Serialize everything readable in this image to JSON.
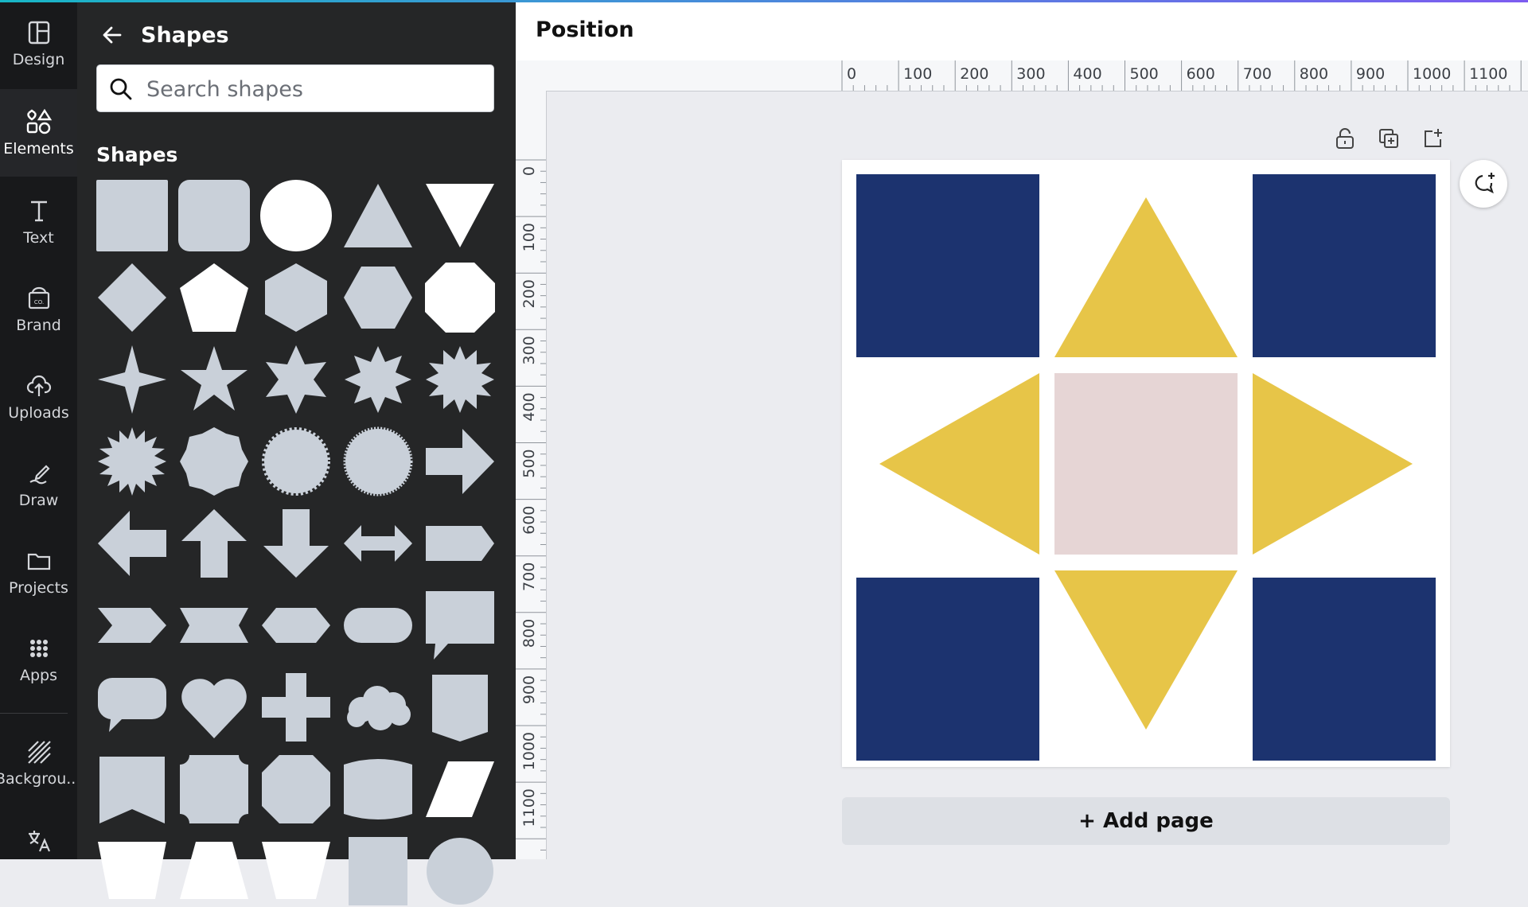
{
  "rail": {
    "items": [
      {
        "label": "Design",
        "icon": "layout-icon"
      },
      {
        "label": "Elements",
        "icon": "shapes-icon"
      },
      {
        "label": "Text",
        "icon": "text-icon"
      },
      {
        "label": "Brand",
        "icon": "brand-icon"
      },
      {
        "label": "Uploads",
        "icon": "upload-cloud-icon"
      },
      {
        "label": "Draw",
        "icon": "draw-icon"
      },
      {
        "label": "Projects",
        "icon": "folder-icon"
      },
      {
        "label": "Apps",
        "icon": "apps-grid-icon"
      },
      {
        "label": "Backgrou...",
        "icon": "background-icon"
      }
    ],
    "active": "Elements"
  },
  "panel": {
    "title": "Shapes",
    "search_placeholder": "Search shapes",
    "section_title": "Shapes"
  },
  "topbar": {
    "title": "Position"
  },
  "ruler": {
    "h_labels": [
      "0",
      "100",
      "200",
      "300",
      "400",
      "500",
      "600",
      "700",
      "800",
      "900",
      "1000",
      "1100"
    ],
    "v_labels": [
      "0",
      "100",
      "200",
      "300",
      "400",
      "500",
      "600",
      "700",
      "800",
      "900",
      "1000",
      "1100"
    ]
  },
  "canvas": {
    "colors": {
      "navy": "#1c336f",
      "yellow": "#e7c548",
      "blush": "#e6d5d5",
      "page": "#ffffff"
    }
  },
  "add_page_label": "+ Add page"
}
